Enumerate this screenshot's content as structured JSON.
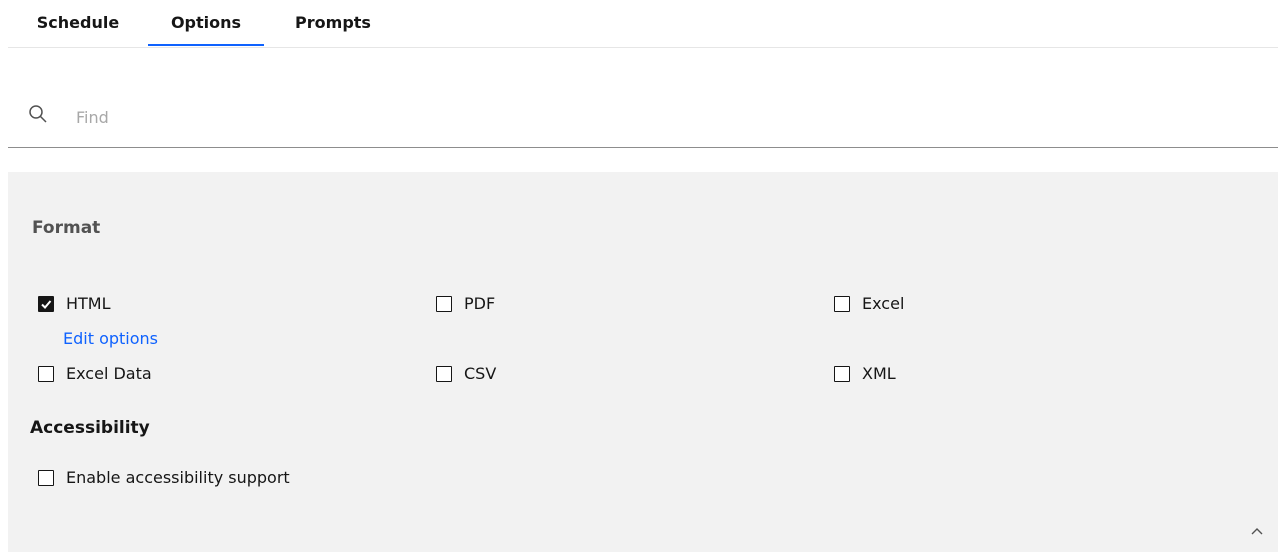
{
  "tabs": [
    {
      "label": "Schedule"
    },
    {
      "label": "Options",
      "active": true
    },
    {
      "label": "Prompts"
    }
  ],
  "search": {
    "placeholder": "Find"
  },
  "format": {
    "title": "Format",
    "options": [
      {
        "label": "HTML",
        "checked": true
      },
      {
        "label": "PDF",
        "checked": false
      },
      {
        "label": "Excel",
        "checked": false
      },
      {
        "label": "Excel Data",
        "checked": false
      },
      {
        "label": "CSV",
        "checked": false
      },
      {
        "label": "XML",
        "checked": false
      }
    ],
    "edit_options_link": "Edit options"
  },
  "accessibility": {
    "title": "Accessibility",
    "option": {
      "label": "Enable accessibility support",
      "checked": false
    }
  },
  "colors": {
    "accent": "#0f62fe",
    "panel_bg": "#f2f2f2"
  },
  "icons": {
    "search": "search-icon",
    "collapse": "chevron-up-icon",
    "check": "checkmark-icon"
  }
}
